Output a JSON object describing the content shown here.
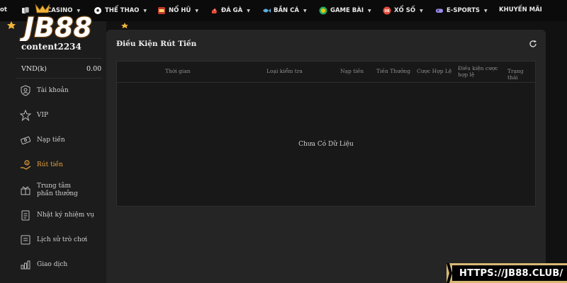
{
  "nav": {
    "partial_left": "ot",
    "items": [
      {
        "label": "CASINO",
        "icon": "cards-icon"
      },
      {
        "label": "THỂ THAO",
        "icon": "soccer-ball-icon"
      },
      {
        "label": "NỔ HŨ",
        "icon": "slot-machine-icon"
      },
      {
        "label": "ĐÁ GÀ",
        "icon": "rooster-icon"
      },
      {
        "label": "BẮN CÁ",
        "icon": "fish-icon"
      },
      {
        "label": "GAME BÀI",
        "icon": "chip-icon"
      },
      {
        "label": "XỔ SỐ",
        "icon": "lottery-ball-icon"
      },
      {
        "label": "E-SPORTS",
        "icon": "gamepad-icon"
      },
      {
        "label": "KHUYẾN MÃI",
        "icon": ""
      }
    ]
  },
  "logo": {
    "text": "JB88"
  },
  "user": {
    "name": "content2234",
    "currency": "VND(k)",
    "balance": "0.00"
  },
  "sidebar": {
    "items": [
      {
        "label": "Tài khoản",
        "icon": "user-shield-icon",
        "active": false
      },
      {
        "label": "VIP",
        "icon": "vip-star-icon",
        "active": false
      },
      {
        "label": "Nạp tiền",
        "icon": "deposit-icon",
        "active": false
      },
      {
        "label": "Rút tiền",
        "icon": "withdraw-icon",
        "active": true
      },
      {
        "label": "Trung tâm phần thưởng",
        "icon": "gift-icon",
        "active": false
      },
      {
        "label": "Nhật ký nhiệm vụ",
        "icon": "clipboard-icon",
        "active": false
      },
      {
        "label": "Lịch sử trò chơi",
        "icon": "history-icon",
        "active": false
      },
      {
        "label": "Giao dịch",
        "icon": "transaction-icon",
        "active": false
      }
    ]
  },
  "main": {
    "title": "Điều Kiện Rút Tiền",
    "columns": [
      "Thời gian",
      "Loại kiểm tra",
      "Nạp tiền",
      "Tiền Thưởng",
      "Cược Hợp Lệ",
      "Điều kiện cược hợp lệ",
      "Trạng thái"
    ],
    "empty_text": "Chưa Có Dữ Liệu"
  },
  "badge": {
    "url": "HTTPS://JB88.CLUB/"
  },
  "colors": {
    "accent": "#e8a33d",
    "panel": "#252525",
    "sidebar": "#1c1c1c",
    "badge_gold": "#d9b875"
  }
}
